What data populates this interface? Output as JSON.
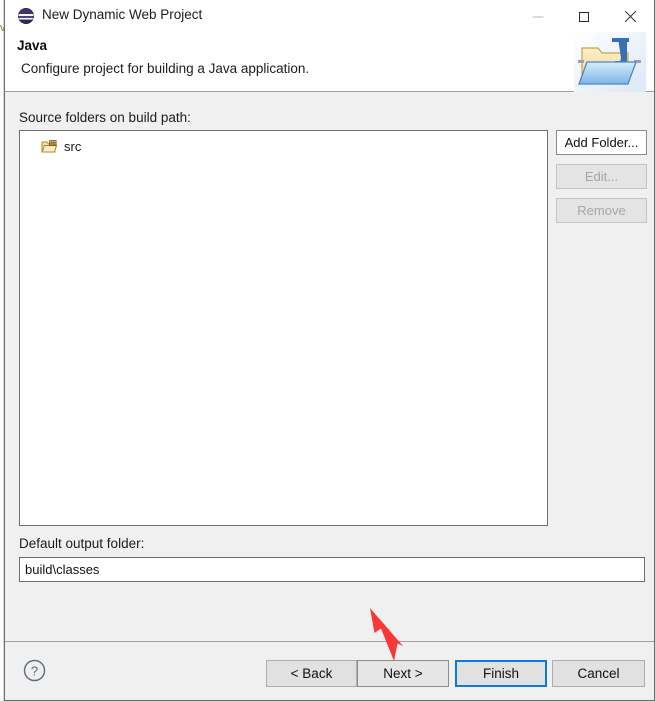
{
  "window": {
    "title": "New Dynamic Web Project",
    "icon": "eclipse-logo-icon",
    "controls": {
      "minimize_label": "—",
      "maximize_label": "□",
      "close_label": "✕"
    }
  },
  "header": {
    "title": "Java",
    "description": "Configure project for building a Java application.",
    "banner_icon": "java-project-folder-icon"
  },
  "body": {
    "source_label": "Source folders on build path:",
    "source_items": [
      {
        "label": "src",
        "icon": "source-folder-icon"
      }
    ],
    "side_buttons": [
      {
        "label": "Add Folder...",
        "name": "add-folder-button",
        "enabled": true
      },
      {
        "label": "Edit...",
        "name": "edit-button",
        "enabled": false
      },
      {
        "label": "Remove",
        "name": "remove-button",
        "enabled": false
      }
    ],
    "output_label": "Default output folder:",
    "output_value": "build\\classes",
    "output_placeholder": "Default output folder"
  },
  "footer": {
    "help_label": "?",
    "buttons": [
      {
        "label": "< Back",
        "name": "back-button",
        "default": false
      },
      {
        "label": "Next >",
        "name": "next-button",
        "default": false
      },
      {
        "label": "Finish",
        "name": "finish-button",
        "default": true
      },
      {
        "label": "Cancel",
        "name": "cancel-button",
        "default": false
      }
    ]
  },
  "annotation": {
    "arrow_color": "#f83737",
    "arrow_target": "Next >"
  },
  "colors": {
    "dialog_background": "#f0f0f0",
    "header_background": "#ffffff",
    "field_background": "#ffffff",
    "border": "#6e6e6e",
    "focus_blue": "#0a7bd6",
    "disabled_text": "#a6a6a6",
    "annotation_red": "#f83737"
  },
  "behind": {
    "sliver_text": "v"
  }
}
